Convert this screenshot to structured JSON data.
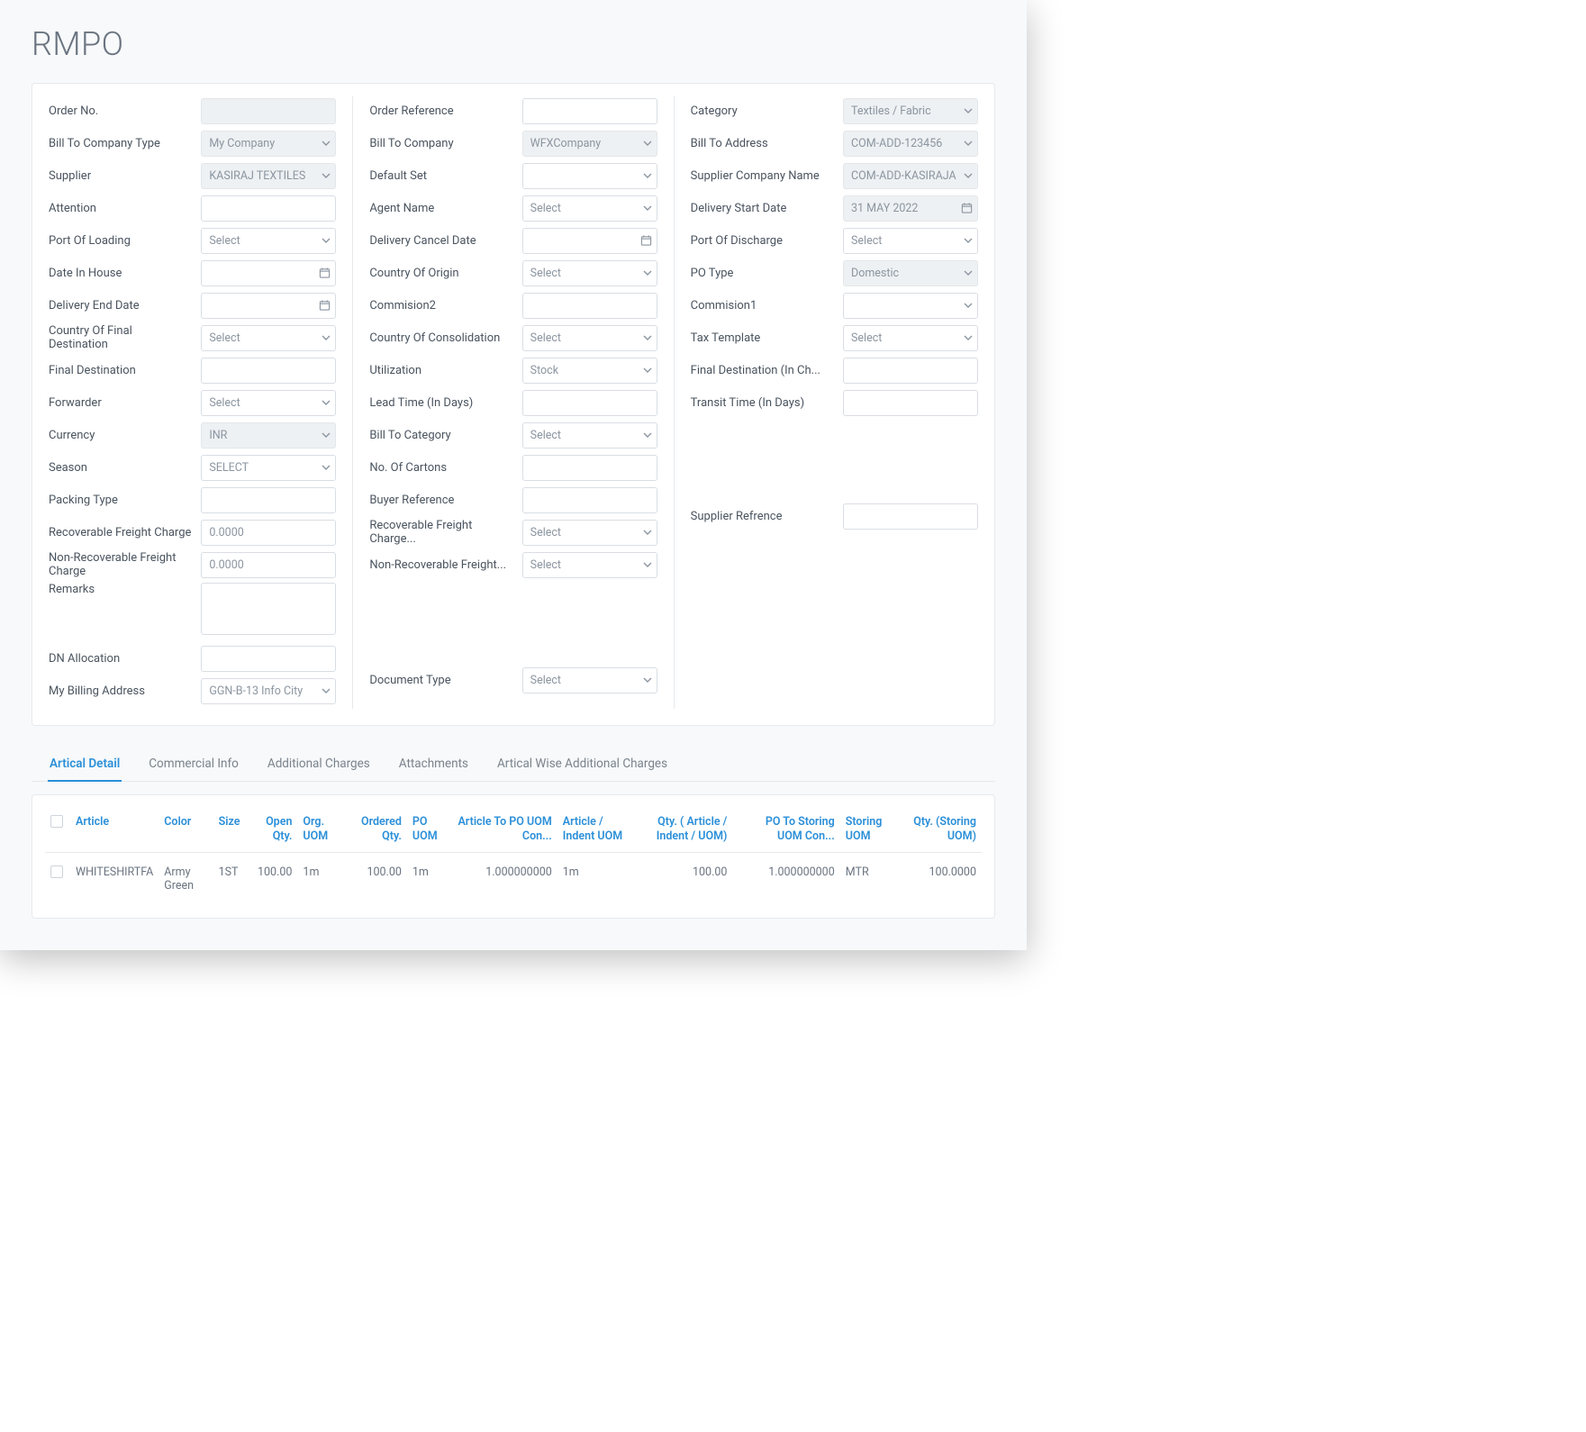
{
  "title": "RMPO",
  "select_placeholder": "Select",
  "form": {
    "col1": [
      {
        "k": "order_no",
        "label": "Order No.",
        "type": "text-readonly",
        "value": ""
      },
      {
        "k": "bill_to_company_type",
        "label": "Bill To Company Type",
        "type": "select-readonly",
        "value": "My Company"
      },
      {
        "k": "supplier",
        "label": "Supplier",
        "type": "select-readonly",
        "value": "KASIRAJ TEXTILES"
      },
      {
        "k": "attention",
        "label": "Attention",
        "type": "text",
        "value": ""
      },
      {
        "k": "port_of_loading",
        "label": "Port Of Loading",
        "type": "select",
        "value": "Select"
      },
      {
        "k": "date_in_house",
        "label": "Date In House",
        "type": "date",
        "value": ""
      },
      {
        "k": "delivery_end_date",
        "label": "Delivery End Date",
        "type": "date",
        "value": ""
      },
      {
        "k": "country_final_dest",
        "label": "Country Of Final Destination",
        "type": "select",
        "value": "Select"
      },
      {
        "k": "final_destination",
        "label": "Final Destination",
        "type": "text",
        "value": ""
      },
      {
        "k": "forwarder",
        "label": "Forwarder",
        "type": "select",
        "value": "Select"
      },
      {
        "k": "currency",
        "label": "Currency",
        "type": "select-readonly",
        "value": "INR"
      },
      {
        "k": "season",
        "label": "Season",
        "type": "select",
        "value": "SELECT"
      },
      {
        "k": "packing_type",
        "label": "Packing Type",
        "type": "text",
        "value": ""
      },
      {
        "k": "recov_freight",
        "label": "Recoverable Freight Charge",
        "type": "text",
        "value": "0.0000"
      },
      {
        "k": "nonrecov_freight",
        "label": "Non-Recoverable Freight Charge",
        "type": "text",
        "value": "0.0000"
      },
      {
        "k": "remarks",
        "label": "Remarks",
        "type": "textarea",
        "value": ""
      },
      {
        "k": "dn_allocation",
        "label": "DN Allocation",
        "type": "text",
        "value": ""
      },
      {
        "k": "my_billing_address",
        "label": "My Billing Address",
        "type": "select",
        "value": "GGN-B-13 Info City"
      }
    ],
    "col2": [
      {
        "k": "order_reference",
        "label": "Order Reference",
        "type": "text",
        "value": ""
      },
      {
        "k": "bill_to_company",
        "label": "Bill To Company",
        "type": "select-readonly",
        "value": "WFXCompany"
      },
      {
        "k": "default_set",
        "label": "Default Set",
        "type": "select",
        "value": ""
      },
      {
        "k": "agent_name",
        "label": "Agent Name",
        "type": "select",
        "value": "Select"
      },
      {
        "k": "delivery_cancel_date",
        "label": "Delivery Cancel Date",
        "type": "date",
        "value": ""
      },
      {
        "k": "country_of_origin",
        "label": "Country Of Origin",
        "type": "select",
        "value": "Select"
      },
      {
        "k": "commision2",
        "label": "Commision2",
        "type": "text",
        "value": ""
      },
      {
        "k": "country_consolidation",
        "label": "Country Of Consolidation",
        "type": "select",
        "value": "Select"
      },
      {
        "k": "utilization",
        "label": "Utilization",
        "type": "select",
        "value": "Stock"
      },
      {
        "k": "lead_time",
        "label": "Lead Time (In Days)",
        "type": "text",
        "value": ""
      },
      {
        "k": "bill_to_category",
        "label": "Bill To Category",
        "type": "select",
        "value": "Select"
      },
      {
        "k": "no_of_cartons",
        "label": "No. Of Cartons",
        "type": "text",
        "value": ""
      },
      {
        "k": "buyer_reference",
        "label": "Buyer Reference",
        "type": "text",
        "value": ""
      },
      {
        "k": "recov_freight_2",
        "label": "Recoverable Freight Charge...",
        "type": "select",
        "value": "Select"
      },
      {
        "k": "nonrecov_freight_2",
        "label": "Non-Recoverable Freight...",
        "type": "select",
        "value": "Select"
      },
      {
        "k": "spacer",
        "label": "",
        "type": "spacer",
        "value": ""
      },
      {
        "k": "spacer2",
        "label": "",
        "type": "spacer-sm",
        "value": ""
      },
      {
        "k": "document_type",
        "label": "Document Type",
        "type": "select",
        "value": "Select"
      }
    ],
    "col3": [
      {
        "k": "category",
        "label": "Category",
        "type": "select-readonly",
        "value": "Textiles / Fabric"
      },
      {
        "k": "bill_to_address",
        "label": "Bill To Address",
        "type": "select-readonly",
        "value": "COM-ADD-123456"
      },
      {
        "k": "supplier_company_name",
        "label": "Supplier Company Name",
        "type": "select-readonly",
        "value": "COM-ADD-KASIRAJA"
      },
      {
        "k": "delivery_start_date",
        "label": "Delivery Start Date",
        "type": "date-readonly",
        "value": "31 MAY 2022"
      },
      {
        "k": "port_of_discharge",
        "label": "Port Of Discharge",
        "type": "select",
        "value": "Select"
      },
      {
        "k": "po_type",
        "label": "PO Type",
        "type": "select-readonly",
        "value": "Domestic"
      },
      {
        "k": "commision1",
        "label": "Commision1",
        "type": "select",
        "value": ""
      },
      {
        "k": "tax_template",
        "label": "Tax Template",
        "type": "select",
        "value": "Select"
      },
      {
        "k": "final_dest_ch",
        "label": "Final Destination (In Ch...",
        "type": "text",
        "value": ""
      },
      {
        "k": "transit_time",
        "label": "Transit Time (In Days)",
        "type": "text",
        "value": ""
      },
      {
        "k": "spacer3",
        "label": "",
        "type": "spacer-row",
        "value": ""
      },
      {
        "k": "spacer4",
        "label": "",
        "type": "spacer-row",
        "value": ""
      },
      {
        "k": "spacer5",
        "label": "",
        "type": "spacer-row-sm",
        "value": ""
      },
      {
        "k": "supplier_refrence",
        "label": "Supplier Refrence",
        "type": "text",
        "value": ""
      }
    ]
  },
  "tabs": [
    {
      "k": "artical_detail",
      "label": "Artical Detail",
      "active": true
    },
    {
      "k": "commercial_info",
      "label": "Commercial Info",
      "active": false
    },
    {
      "k": "additional_charges",
      "label": "Additional Charges",
      "active": false
    },
    {
      "k": "attachments",
      "label": "Attachments",
      "active": false
    },
    {
      "k": "artical_wise",
      "label": "Artical Wise Additional Charges",
      "active": false
    }
  ],
  "table": {
    "headers": [
      {
        "k": "article",
        "label": "Article",
        "align": "l"
      },
      {
        "k": "color",
        "label": "Color",
        "align": "l"
      },
      {
        "k": "size",
        "label": "Size",
        "align": "l"
      },
      {
        "k": "open_qty",
        "label": "Open Qty.",
        "align": "r"
      },
      {
        "k": "org_uom",
        "label": "Org. UOM",
        "align": "l"
      },
      {
        "k": "ordered_qty",
        "label": "Ordered Qty.",
        "align": "r"
      },
      {
        "k": "po_uom",
        "label": "PO UOM",
        "align": "l"
      },
      {
        "k": "article_to_po",
        "label": "Article To PO UOM Con...",
        "align": "r"
      },
      {
        "k": "article_indent_uom",
        "label": "Article / Indent UOM",
        "align": "l"
      },
      {
        "k": "qty_article_uom",
        "label": "Qty. ( Article / Indent / UOM)",
        "align": "r"
      },
      {
        "k": "po_to_storing",
        "label": "PO To Storing UOM Con...",
        "align": "r"
      },
      {
        "k": "storing_uom",
        "label": "Storing UOM",
        "align": "l"
      },
      {
        "k": "qty_storing",
        "label": "Qty. (Storing UOM)",
        "align": "r"
      }
    ],
    "rows": [
      {
        "article": "WHITESHIRTFA",
        "color": "Army Green",
        "size": "1ST",
        "open_qty": "100.00",
        "org_uom": "1m",
        "ordered_qty": "100.00",
        "po_uom": "1m",
        "article_to_po": "1.000000000",
        "article_indent_uom": "1m",
        "qty_article_uom": "100.00",
        "po_to_storing": "1.000000000",
        "storing_uom": "MTR",
        "qty_storing": "100.0000"
      }
    ]
  }
}
